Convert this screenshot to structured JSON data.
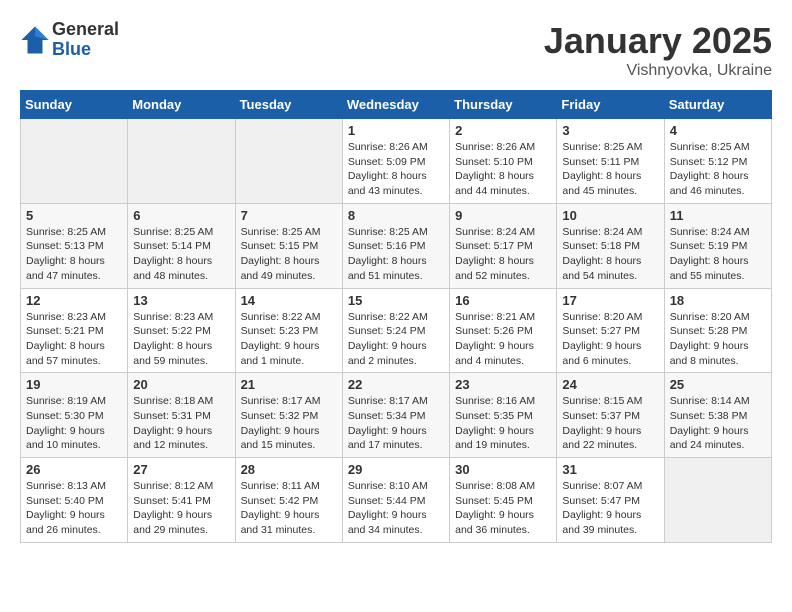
{
  "header": {
    "logo_general": "General",
    "logo_blue": "Blue",
    "month_title": "January 2025",
    "location": "Vishnyovka, Ukraine"
  },
  "weekdays": [
    "Sunday",
    "Monday",
    "Tuesday",
    "Wednesday",
    "Thursday",
    "Friday",
    "Saturday"
  ],
  "weeks": [
    [
      {
        "day": "",
        "info": ""
      },
      {
        "day": "",
        "info": ""
      },
      {
        "day": "",
        "info": ""
      },
      {
        "day": "1",
        "info": "Sunrise: 8:26 AM\nSunset: 5:09 PM\nDaylight: 8 hours\nand 43 minutes."
      },
      {
        "day": "2",
        "info": "Sunrise: 8:26 AM\nSunset: 5:10 PM\nDaylight: 8 hours\nand 44 minutes."
      },
      {
        "day": "3",
        "info": "Sunrise: 8:25 AM\nSunset: 5:11 PM\nDaylight: 8 hours\nand 45 minutes."
      },
      {
        "day": "4",
        "info": "Sunrise: 8:25 AM\nSunset: 5:12 PM\nDaylight: 8 hours\nand 46 minutes."
      }
    ],
    [
      {
        "day": "5",
        "info": "Sunrise: 8:25 AM\nSunset: 5:13 PM\nDaylight: 8 hours\nand 47 minutes."
      },
      {
        "day": "6",
        "info": "Sunrise: 8:25 AM\nSunset: 5:14 PM\nDaylight: 8 hours\nand 48 minutes."
      },
      {
        "day": "7",
        "info": "Sunrise: 8:25 AM\nSunset: 5:15 PM\nDaylight: 8 hours\nand 49 minutes."
      },
      {
        "day": "8",
        "info": "Sunrise: 8:25 AM\nSunset: 5:16 PM\nDaylight: 8 hours\nand 51 minutes."
      },
      {
        "day": "9",
        "info": "Sunrise: 8:24 AM\nSunset: 5:17 PM\nDaylight: 8 hours\nand 52 minutes."
      },
      {
        "day": "10",
        "info": "Sunrise: 8:24 AM\nSunset: 5:18 PM\nDaylight: 8 hours\nand 54 minutes."
      },
      {
        "day": "11",
        "info": "Sunrise: 8:24 AM\nSunset: 5:19 PM\nDaylight: 8 hours\nand 55 minutes."
      }
    ],
    [
      {
        "day": "12",
        "info": "Sunrise: 8:23 AM\nSunset: 5:21 PM\nDaylight: 8 hours\nand 57 minutes."
      },
      {
        "day": "13",
        "info": "Sunrise: 8:23 AM\nSunset: 5:22 PM\nDaylight: 8 hours\nand 59 minutes."
      },
      {
        "day": "14",
        "info": "Sunrise: 8:22 AM\nSunset: 5:23 PM\nDaylight: 9 hours\nand 1 minute."
      },
      {
        "day": "15",
        "info": "Sunrise: 8:22 AM\nSunset: 5:24 PM\nDaylight: 9 hours\nand 2 minutes."
      },
      {
        "day": "16",
        "info": "Sunrise: 8:21 AM\nSunset: 5:26 PM\nDaylight: 9 hours\nand 4 minutes."
      },
      {
        "day": "17",
        "info": "Sunrise: 8:20 AM\nSunset: 5:27 PM\nDaylight: 9 hours\nand 6 minutes."
      },
      {
        "day": "18",
        "info": "Sunrise: 8:20 AM\nSunset: 5:28 PM\nDaylight: 9 hours\nand 8 minutes."
      }
    ],
    [
      {
        "day": "19",
        "info": "Sunrise: 8:19 AM\nSunset: 5:30 PM\nDaylight: 9 hours\nand 10 minutes."
      },
      {
        "day": "20",
        "info": "Sunrise: 8:18 AM\nSunset: 5:31 PM\nDaylight: 9 hours\nand 12 minutes."
      },
      {
        "day": "21",
        "info": "Sunrise: 8:17 AM\nSunset: 5:32 PM\nDaylight: 9 hours\nand 15 minutes."
      },
      {
        "day": "22",
        "info": "Sunrise: 8:17 AM\nSunset: 5:34 PM\nDaylight: 9 hours\nand 17 minutes."
      },
      {
        "day": "23",
        "info": "Sunrise: 8:16 AM\nSunset: 5:35 PM\nDaylight: 9 hours\nand 19 minutes."
      },
      {
        "day": "24",
        "info": "Sunrise: 8:15 AM\nSunset: 5:37 PM\nDaylight: 9 hours\nand 22 minutes."
      },
      {
        "day": "25",
        "info": "Sunrise: 8:14 AM\nSunset: 5:38 PM\nDaylight: 9 hours\nand 24 minutes."
      }
    ],
    [
      {
        "day": "26",
        "info": "Sunrise: 8:13 AM\nSunset: 5:40 PM\nDaylight: 9 hours\nand 26 minutes."
      },
      {
        "day": "27",
        "info": "Sunrise: 8:12 AM\nSunset: 5:41 PM\nDaylight: 9 hours\nand 29 minutes."
      },
      {
        "day": "28",
        "info": "Sunrise: 8:11 AM\nSunset: 5:42 PM\nDaylight: 9 hours\nand 31 minutes."
      },
      {
        "day": "29",
        "info": "Sunrise: 8:10 AM\nSunset: 5:44 PM\nDaylight: 9 hours\nand 34 minutes."
      },
      {
        "day": "30",
        "info": "Sunrise: 8:08 AM\nSunset: 5:45 PM\nDaylight: 9 hours\nand 36 minutes."
      },
      {
        "day": "31",
        "info": "Sunrise: 8:07 AM\nSunset: 5:47 PM\nDaylight: 9 hours\nand 39 minutes."
      },
      {
        "day": "",
        "info": ""
      }
    ]
  ]
}
